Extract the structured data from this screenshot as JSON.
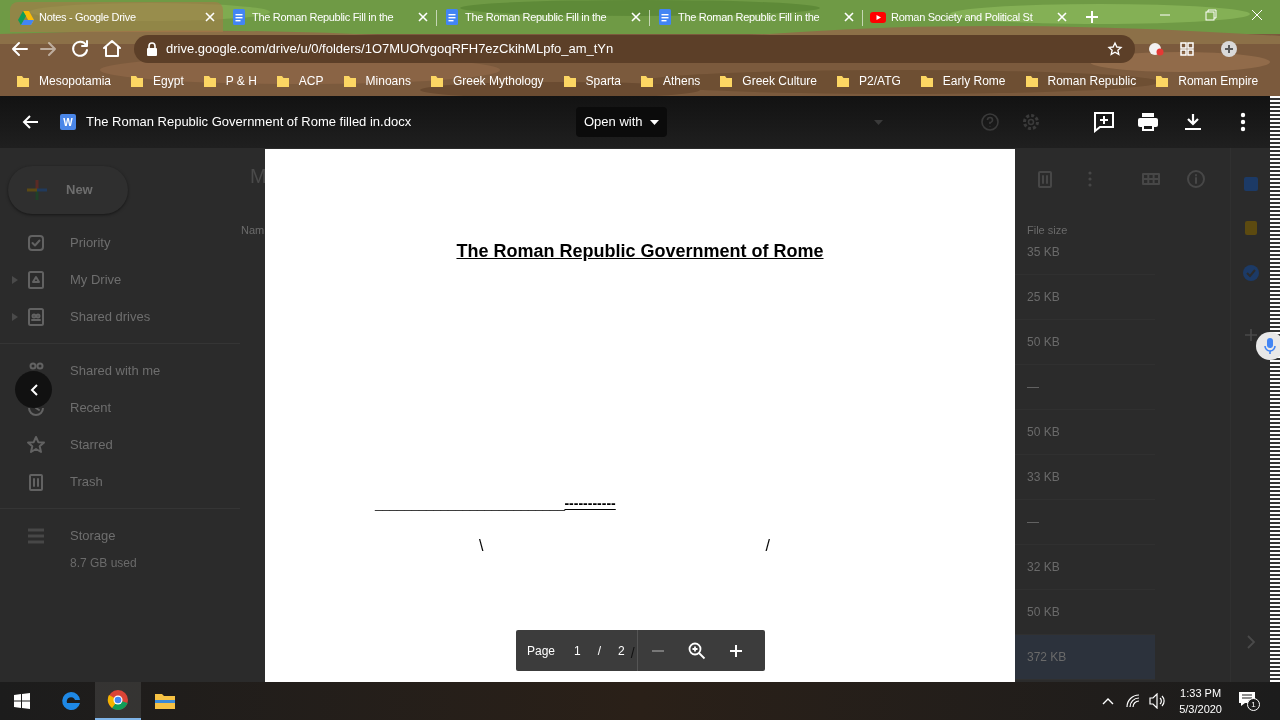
{
  "browser": {
    "tabs": [
      {
        "title": "Notes - Google Drive",
        "kind": "drive",
        "selected": true
      },
      {
        "title": "The Roman Republic Fill in the",
        "kind": "docs",
        "selected": false
      },
      {
        "title": "The Roman Republic Fill in the",
        "kind": "docs",
        "selected": false
      },
      {
        "title": "The Roman Republic Fill in the",
        "kind": "docs",
        "selected": false
      },
      {
        "title": "Roman Society and Political St",
        "kind": "youtube",
        "selected": false
      }
    ],
    "url": "drive.google.com/drive/u/0/folders/1O7MUOfvgoqRFH7ezCkihMLpfo_am_tYn",
    "bookmarks": [
      "Mesopotamia",
      "Egypt",
      "P & H",
      "ACP",
      "Minoans",
      "Greek Mythology",
      "Sparta",
      "Athens",
      "Greek Culture",
      "P2/ATG",
      "Early Rome",
      "Roman Republic",
      "Roman Empire"
    ]
  },
  "drive": {
    "new_button": "New",
    "nav_groups": [
      {
        "items": [
          {
            "label": "Priority",
            "kind": "priority"
          },
          {
            "label": "My Drive",
            "kind": "mydrive"
          },
          {
            "label": "Shared drives",
            "kind": "shared"
          }
        ]
      },
      {
        "items": [
          {
            "label": "Shared with me",
            "kind": "people"
          },
          {
            "label": "Recent",
            "kind": "recent"
          },
          {
            "label": "Starred",
            "kind": "star"
          },
          {
            "label": "Trash",
            "kind": "trash"
          }
        ]
      }
    ],
    "storage": {
      "label": "Storage",
      "used": "8.7 GB used"
    },
    "heading_partial": "M",
    "name_header_partial": "Nam",
    "size_header": "File size",
    "rows": [
      {
        "size": "35 KB",
        "selected": false
      },
      {
        "size": "25 KB",
        "selected": false
      },
      {
        "size": "50 KB",
        "selected": false
      },
      {
        "size": "—",
        "selected": false
      },
      {
        "size": "50 KB",
        "selected": false
      },
      {
        "size": "33 KB",
        "selected": false
      },
      {
        "size": "—",
        "selected": false
      },
      {
        "size": "32 KB",
        "selected": false
      },
      {
        "size": "50 KB",
        "selected": false
      },
      {
        "size": "372 KB",
        "selected": true
      }
    ]
  },
  "viewer": {
    "file_badge": "W",
    "file_name": "The Roman Republic Government of Rome filled in.docx",
    "open_with": "Open with",
    "document": {
      "title": "The Roman Republic Government of Rome",
      "blank_line": "__________________________",
      "dashes": "-----------",
      "left_mark": "\\",
      "right_mark": "/"
    },
    "pager": {
      "label": "Page",
      "current": "1",
      "separator": "/",
      "total": "2",
      "stray_mark": "/"
    }
  },
  "taskbar": {
    "time": "1:33 PM",
    "date": "5/3/2020",
    "notification_count": "1"
  }
}
